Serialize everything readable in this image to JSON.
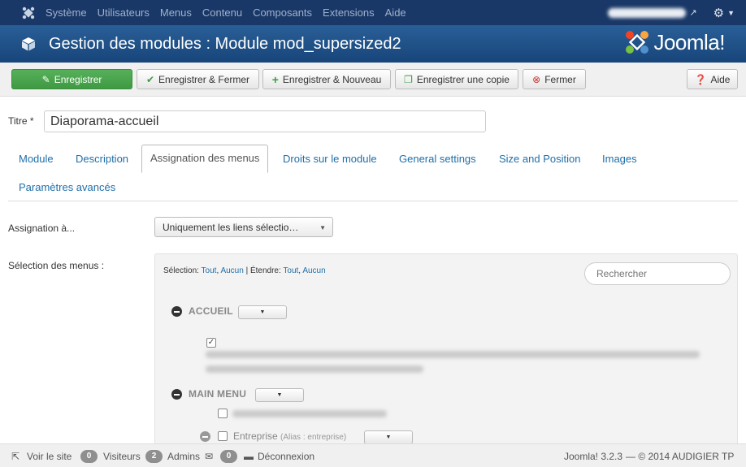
{
  "topbar": {
    "menu": [
      "Système",
      "Utilisateurs",
      "Menus",
      "Contenu",
      "Composants",
      "Extensions",
      "Aide"
    ]
  },
  "header": {
    "title": "Gestion des modules : Module mod_supersized2",
    "brand": "Joomla!"
  },
  "toolbar": {
    "save": "Enregistrer",
    "save_close": "Enregistrer & Fermer",
    "save_new": "Enregistrer & Nouveau",
    "save_copy": "Enregistrer une copie",
    "close": "Fermer",
    "help": "Aide"
  },
  "form": {
    "title_label": "Titre *",
    "title_value": "Diaporama-accueil",
    "assign_label": "Assignation à...",
    "assign_value": "Uniquement les liens sélectio…",
    "menus_label": "Sélection des menus :"
  },
  "tabs": [
    "Module",
    "Description",
    "Assignation des menus",
    "Droits sur le module",
    "General settings",
    "Size and Position",
    "Images",
    "Paramètres avancés"
  ],
  "menus_panel": {
    "selection_label": "Sélection:",
    "all": "Tout",
    "none": "Aucun",
    "extend_label": "| Étendre:",
    "extend_all": "Tout",
    "extend_none": "Aucun",
    "search_placeholder": "Rechercher",
    "groups": [
      {
        "title": "ACCUEIL"
      },
      {
        "title": "MAIN MENU"
      }
    ],
    "items": {
      "entreprise": "Entreprise",
      "entreprise_alias": "(Alias : entreprise)"
    }
  },
  "statusbar": {
    "view_site": "Voir le site",
    "visitors_count": "0",
    "visitors": "Visiteurs",
    "admins_count": "2",
    "admins": "Admins",
    "messages_count": "0",
    "logout": "Déconnexion",
    "version": "Joomla! 3.2.3",
    "copyright": "— © 2014 AUDIGIER TP"
  }
}
